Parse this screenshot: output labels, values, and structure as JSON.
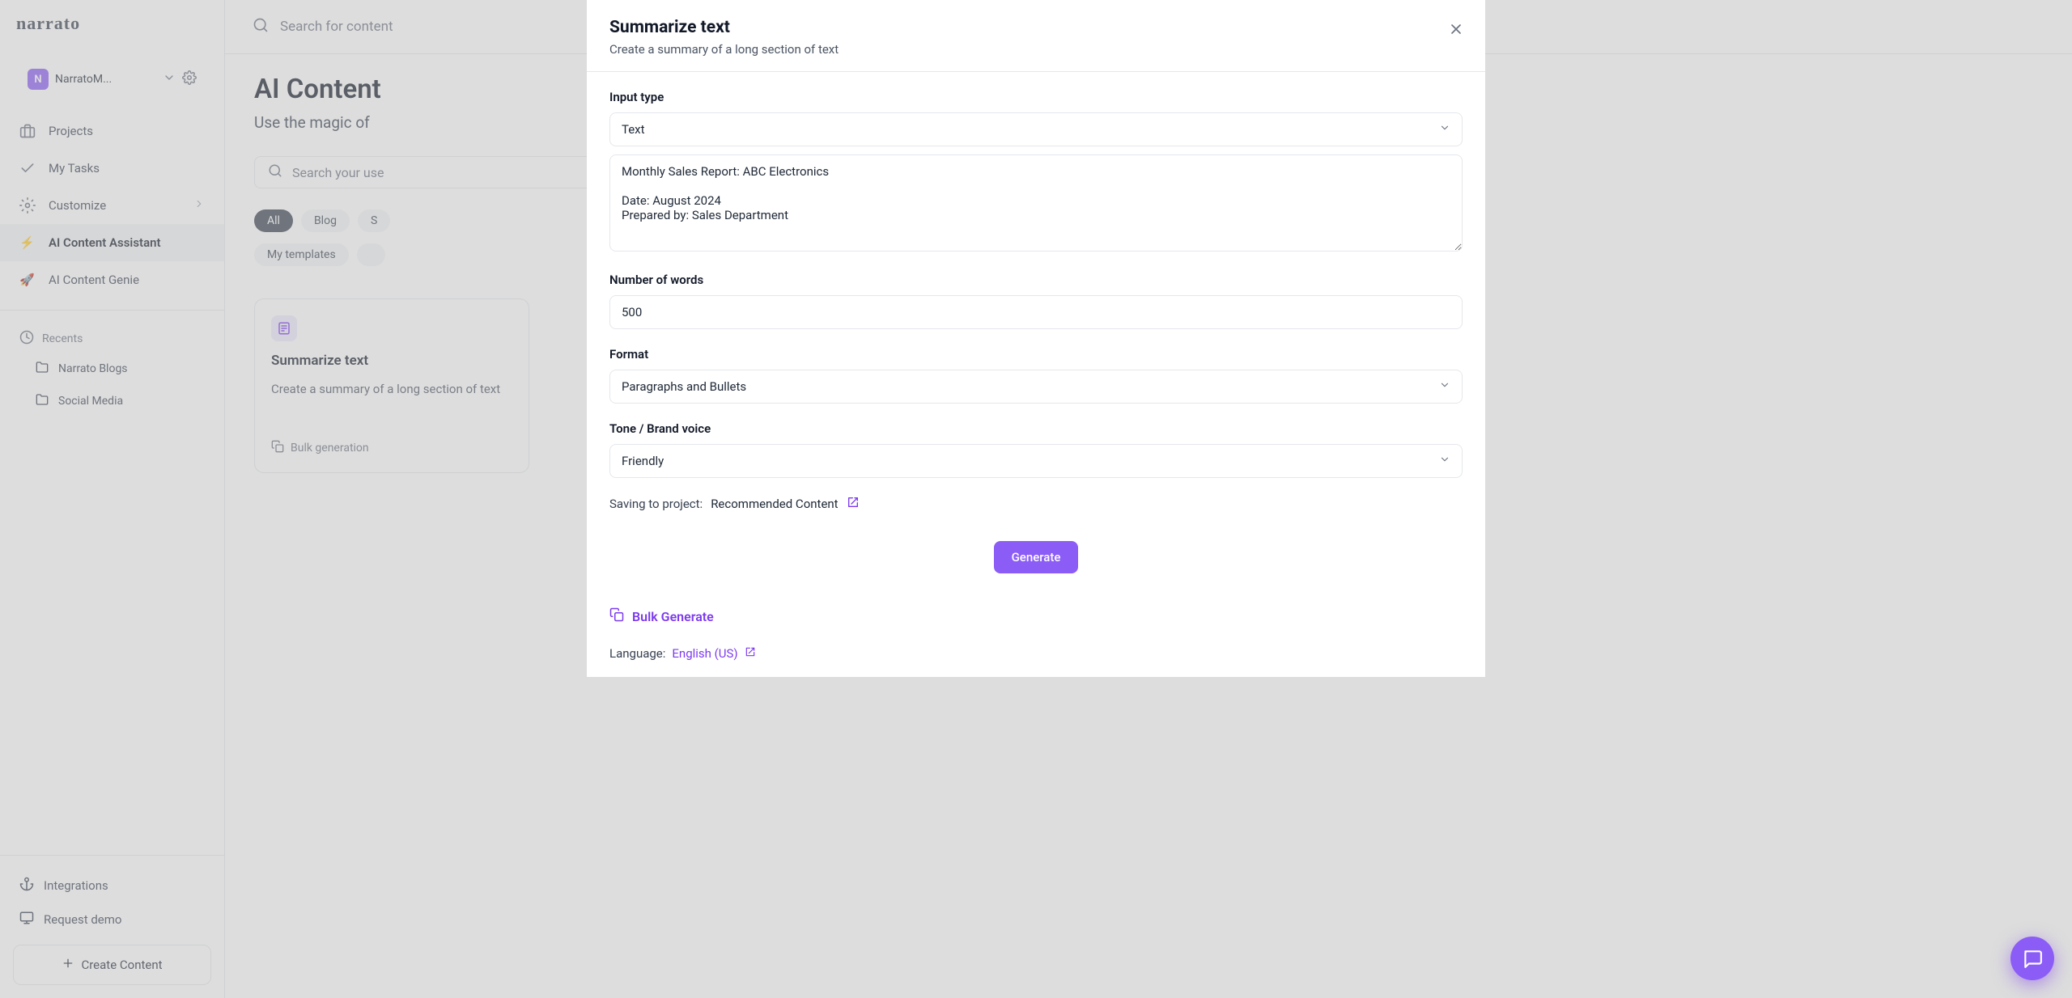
{
  "workspace": {
    "initial": "N",
    "name": "NarratoM..."
  },
  "sidebar": {
    "nav": [
      {
        "label": "Projects"
      },
      {
        "label": "My Tasks"
      },
      {
        "label": "Customize"
      },
      {
        "label": "AI Content Assistant"
      },
      {
        "label": "AI Content Genie"
      }
    ],
    "recents_label": "Recents",
    "recents": [
      {
        "label": "Narrato Blogs"
      },
      {
        "label": "Social Media"
      }
    ],
    "footer": {
      "integrations": "Integrations",
      "request_demo": "Request demo",
      "create_content": "Create Content"
    }
  },
  "topbar": {
    "search_placeholder": "Search for content"
  },
  "page": {
    "title": "AI Content",
    "subtitle_prefix": "Use the magic of",
    "usecase_search_placeholder": "Search your use",
    "chips1": [
      "All",
      "Blog",
      "S"
    ],
    "chips2": [
      "My templates"
    ]
  },
  "card": {
    "title": "Summarize text",
    "desc": "Create a summary of a long section of text",
    "foot": "Bulk generation"
  },
  "modal": {
    "title": "Summarize text",
    "subtitle": "Create a summary of a long section of text",
    "input_type_label": "Input type",
    "input_type_value": "Text",
    "textarea_value": "Monthly Sales Report: ABC Electronics\n\nDate: August 2024\nPrepared by: Sales Department",
    "num_words_label": "Number of words",
    "num_words_value": "500",
    "format_label": "Format",
    "format_value": "Paragraphs and Bullets",
    "tone_label": "Tone / Brand voice",
    "tone_value": "Friendly",
    "saving_prefix": "Saving to project:",
    "saving_project": "Recommended Content",
    "generate": "Generate",
    "bulk_generate": "Bulk Generate",
    "language_prefix": "Language:",
    "language_value": "English (US)"
  }
}
